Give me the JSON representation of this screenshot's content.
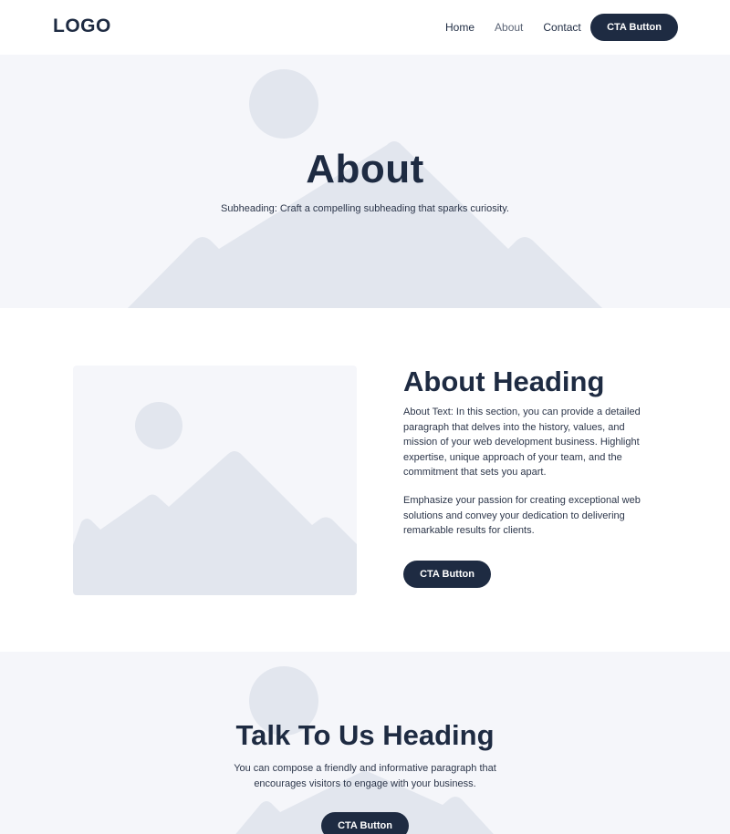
{
  "header": {
    "logo": "LOGO",
    "nav": [
      {
        "label": "Home"
      },
      {
        "label": "About"
      },
      {
        "label": "Contact"
      }
    ],
    "cta_label": "CTA Button"
  },
  "hero": {
    "title": "About",
    "subheading": "Subheading: Craft a compelling subheading that sparks curiosity.",
    "background_icon": "image-placeholder-icon"
  },
  "about": {
    "image_icon": "image-placeholder-icon",
    "heading": "About Heading",
    "paragraph_1": "About Text: In this section, you can provide a detailed paragraph that delves into the history, values, and mission of your web development business. Highlight expertise, unique approach of your team, and the commitment that sets you apart.",
    "paragraph_2": "Emphasize your passion for creating exceptional web solutions and convey your dedication to delivering remarkable results for clients.",
    "cta_label": "CTA Button"
  },
  "talk": {
    "heading": "Talk To Us Heading",
    "text": "You can compose a friendly and informative paragraph that encourages visitors to engage with your business.",
    "cta_label": "CTA Button"
  },
  "colors": {
    "primary": "#1e2b42",
    "section_bg": "#f5f6fa",
    "placeholder": "#e2e6ee"
  }
}
